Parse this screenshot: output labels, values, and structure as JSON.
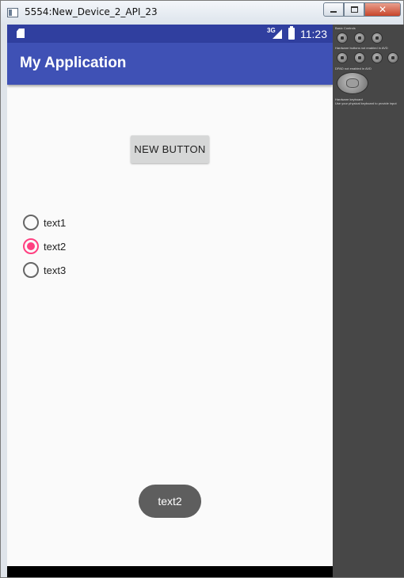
{
  "window": {
    "title": "5554:New_Device_2_API_23",
    "close_glyph": "✕"
  },
  "status_bar": {
    "network": "3G",
    "time": "11:23"
  },
  "app_bar": {
    "title": "My Application"
  },
  "main": {
    "button_label": "NEW BUTTON",
    "radio_options": [
      {
        "label": "text1",
        "checked": false
      },
      {
        "label": "text2",
        "checked": true
      },
      {
        "label": "text3",
        "checked": false
      }
    ],
    "toast_text": "text2"
  },
  "colors": {
    "status_bar": "#303f9f",
    "app_bar": "#3f51b5",
    "accent": "#ff4081",
    "toast": "#5e5e5e",
    "controls_panel": "#474747"
  },
  "controls_panel": {
    "section_labels": [
      "Basic Controls",
      "Hardware buttons not enabled in AVD",
      "DPAD not enabled in AVD",
      "Hardware keyboard",
      "Use your physical keyboard to provide input"
    ]
  }
}
